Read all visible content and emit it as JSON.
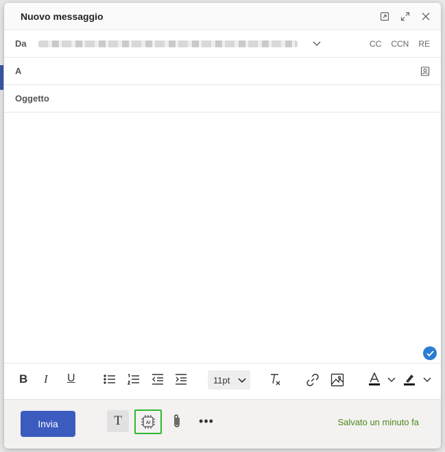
{
  "dialog": {
    "title": "Nuovo messaggio",
    "controls": [
      "popout-icon",
      "expand-icon",
      "close-icon"
    ]
  },
  "from": {
    "label": "Da",
    "value_obscured": true
  },
  "recipients": {
    "cc": "CC",
    "bcc": "CCN",
    "reply": "RE"
  },
  "to": {
    "label": "A",
    "value": ""
  },
  "subject": {
    "label": "Oggetto",
    "value": ""
  },
  "format": {
    "bold": "B",
    "italic": "I",
    "underline": "U",
    "font_size": "11pt"
  },
  "footer": {
    "send": "Invia",
    "text_format": "T",
    "ai_label": "AI",
    "more": "•••",
    "status": "Salvato un minuto fa"
  },
  "colors": {
    "send": "#3b5bbf",
    "status": "#4a8a1a",
    "ai_highlight": "#2eb82e"
  }
}
